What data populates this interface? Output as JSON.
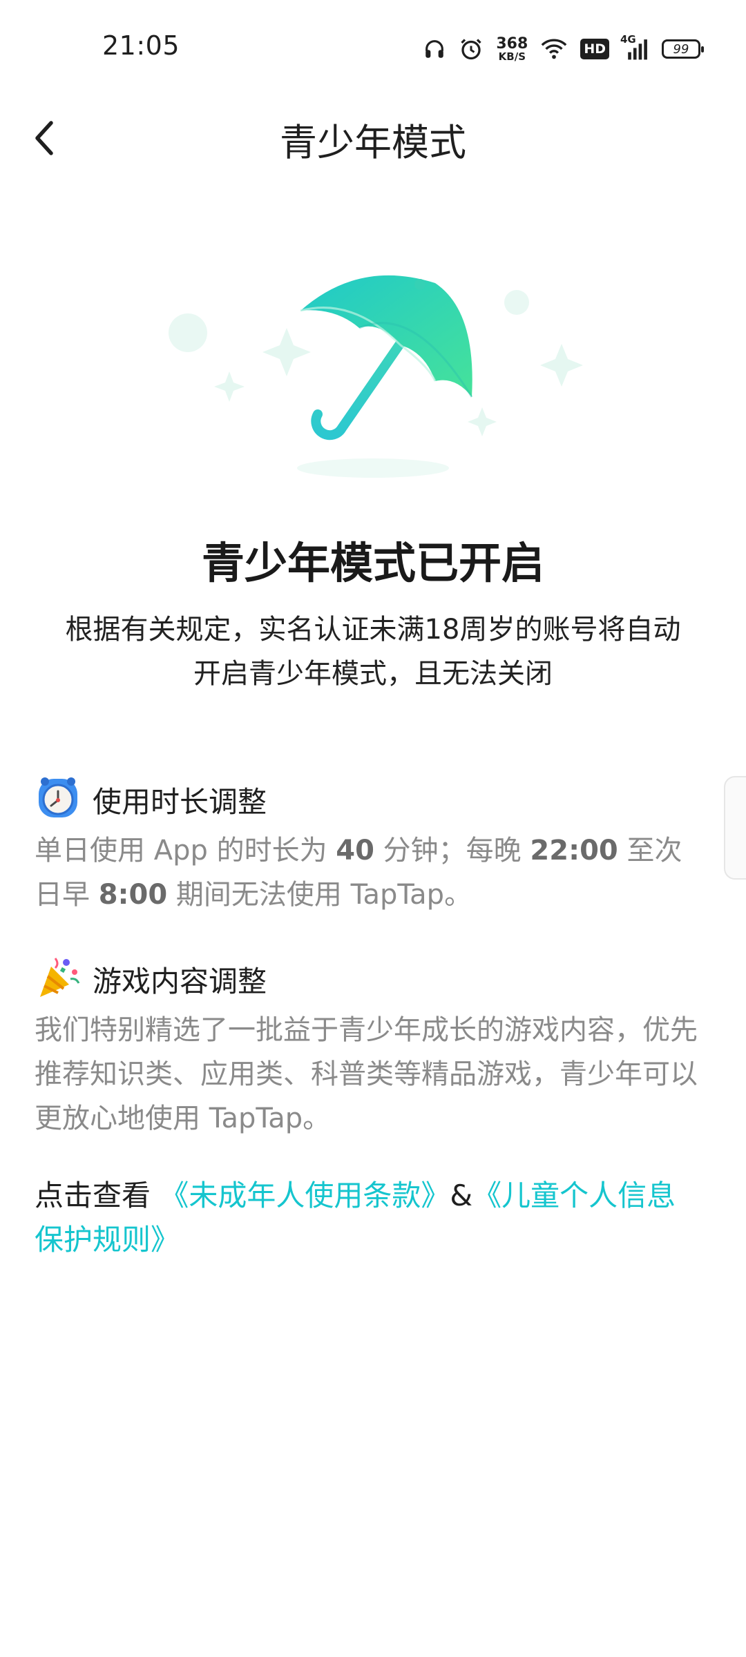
{
  "status_bar": {
    "time": "21:05",
    "net_speed_value": "368",
    "net_speed_unit": "KB/S",
    "hd_badge": "HD",
    "signal_label": "4G",
    "battery": "99",
    "icons": [
      "headphones-icon",
      "alarm-icon",
      "wifi-icon",
      "hd-icon",
      "signal-icon",
      "battery-icon"
    ]
  },
  "nav": {
    "title": "青少年模式",
    "back_icon": "chevron-left-icon"
  },
  "illustration": {
    "icon": "umbrella-illustration",
    "accent": "#2ed6b4"
  },
  "headline": "青少年模式已开启",
  "intro": "根据有关规定，实名认证未满18周岁的账号将自动开启青少年模式，且无法关闭",
  "sections": [
    {
      "icon": "alarm-clock-icon",
      "title": "使用时长调整",
      "body_parts": [
        "单日使用 App 的时长为 ",
        "40",
        " 分钟；每晚 ",
        "22:00",
        " 至次日早 ",
        "8:00",
        " 期间无法使用 TapTap。"
      ]
    },
    {
      "icon": "party-popper-icon",
      "title": "游戏内容调整",
      "body": "我们特别精选了一批益于青少年成长的游戏内容，优先推荐知识类、应用类、科普类等精品游戏，青少年可以更放心地使用 TapTap。"
    }
  ],
  "links": {
    "prefix": "点击查看 ",
    "terms": "《未成年人使用条款》",
    "separator": "&",
    "privacy": "《儿童个人信息保护规则》",
    "color": "#15c5ce"
  }
}
